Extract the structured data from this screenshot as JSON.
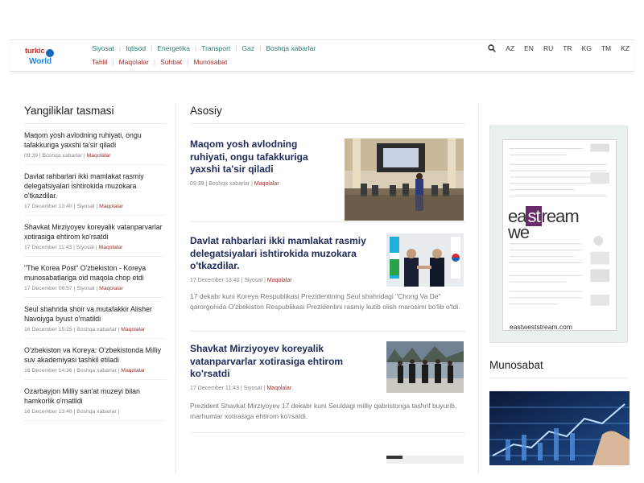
{
  "header": {
    "logo_top": "turkic",
    "logo_bottom": "World",
    "nav_row1": [
      "Siyosat",
      "Iqtisod",
      "Energetika",
      "Transport",
      "Gaz",
      "Boshqa xabarlar"
    ],
    "nav_row2": [
      "Tahlil",
      "Maqolalar",
      "Suhbat",
      "Munosabat"
    ],
    "languages": [
      "AZ",
      "EN",
      "RU",
      "TR",
      "KG",
      "TM",
      "KZ"
    ],
    "search_icon": "search-icon"
  },
  "left": {
    "title": "Yangiliklar tasmasi",
    "items": [
      {
        "title": "Maqom yosh avlodning ruhiyati, ongu tafakkuriga yaxshi ta'sir qiladi",
        "meta": "09:39 | Boshqa xabarlar | ",
        "cat": "Maqolalar"
      },
      {
        "title": "Davlat rahbarlari ikki mamlakat rasmiy delegatsiyalari ishtirokida muzokara o'tkazdilar.",
        "meta": "17 December 13:40 | Siyosat | ",
        "cat": "Maqolalar"
      },
      {
        "title": "Shavkat Mirziyoyev koreyalik vatanparvarlar xotirasiga ehtirom ko'rsatdi",
        "meta": "17 December 11:43 | Siyosat | ",
        "cat": "Maqolalar"
      },
      {
        "title": "\"The Korea Post\" O'zbekiston - Koreya munosabatlariga oid maqola chop etdi",
        "meta": "17 December 08:57 | Siyosat | ",
        "cat": "Maqolalar"
      },
      {
        "title": "Seul shahrida shoir va mutafakkir Alisher Navoiyga byust o'rnatildi",
        "meta": "16 December 15:25 | Boshqa xabarlar | ",
        "cat": "Maqolalar"
      },
      {
        "title": "O'zbekiston va Koreya: O'zbekistonda Milliy suv akademiyasi tashkil etiladi",
        "meta": "16 December 14:36 | Boshqa xabarlar | ",
        "cat": "Maqolalar"
      },
      {
        "title": "Ozarbayjon Milliy san'at muzeyi bilan hamkorlik o'rnatildi",
        "meta": "16 December 13:48 | Boshqa xabarlar | ",
        "cat": ""
      }
    ]
  },
  "main": {
    "title": "Asosiy",
    "articles": [
      {
        "title": "Maqom yosh avlodning ruhiyati, ongu tafakkuriga yaxshi ta'sir qiladi",
        "meta": "09:39 | Boshqa xabarlar | ",
        "cat": "Maqolalar",
        "excerpt": ""
      },
      {
        "title": "Davlat rahbarlari ikki mamlakat rasmiy delegatsiyalari ishtirokida muzokara o'tkazdilar.",
        "meta": "17 December 13:40 | Siyosat | ",
        "cat": "Maqolalar",
        "excerpt": "17 dekabr kuni Koreya Respublikasi Prezidentining Seul shahridagi \"Chong Va De\" qarorgohida O'zbekiston Respublikasi Prezidentini rasmiy kutib olish marosimi bo'lib o'tdi."
      },
      {
        "title": "Shavkat Mirziyoyev koreyalik vatanparvarlar xotirasiga ehtirom ko'rsatdi",
        "meta": "17 December 11:43 | Siyosat | ",
        "cat": "Maqolalar",
        "excerpt": "Prezident Shavkat Mirziyoyev 17 dekabr kuni Seuldagi milliy qabristonga tashrif buyurib, marhumlar xotirasiga ehtirom ko'rsatdi."
      }
    ]
  },
  "right": {
    "ad_brand_a": "ea",
    "ad_brand_b": "st",
    "ad_brand_c": "we",
    "ad_brand_d": "ream",
    "ad_url": "eastweststream.com",
    "section_title": "Munosabat"
  },
  "colors": {
    "nav1": "#2a7a6f",
    "nav2": "#9c2f2f",
    "headline": "#1e2a5a",
    "accent": "#9c2f2f"
  }
}
